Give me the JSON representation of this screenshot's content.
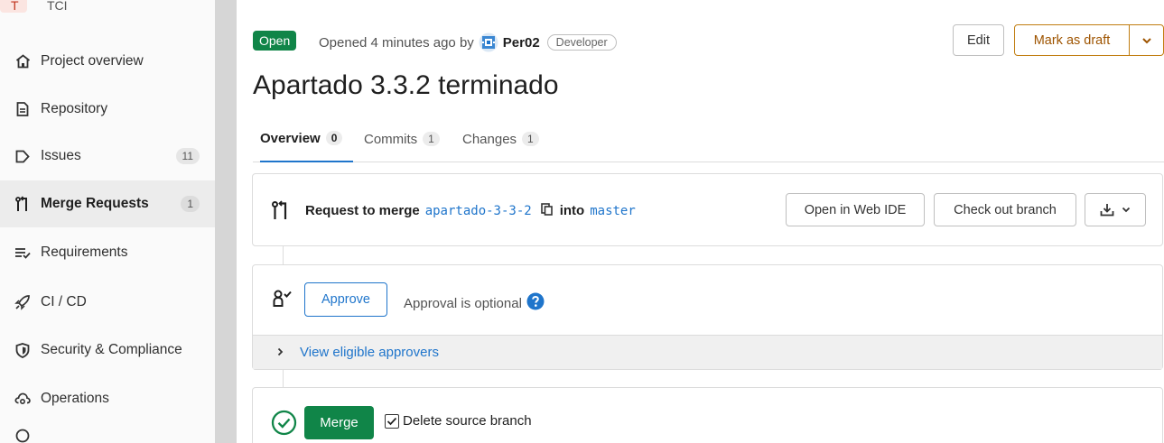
{
  "sidebar": {
    "top_fragment": "TCI",
    "avatar_letter": "T",
    "items": [
      {
        "label": "Project overview",
        "icon": "home-icon"
      },
      {
        "label": "Repository",
        "icon": "document-icon"
      },
      {
        "label": "Issues",
        "icon": "issues-icon",
        "count": "11"
      },
      {
        "label": "Merge Requests",
        "icon": "merge-request-icon",
        "count": "1",
        "active": true
      },
      {
        "label": "Requirements",
        "icon": "requirements-icon"
      },
      {
        "label": "CI / CD",
        "icon": "rocket-icon"
      },
      {
        "label": "Security & Compliance",
        "icon": "shield-icon"
      },
      {
        "label": "Operations",
        "icon": "cloud-gear-icon"
      }
    ]
  },
  "header": {
    "status": "Open",
    "opened_text": "Opened 4 minutes ago by",
    "author": "Per02",
    "role": "Developer",
    "edit_label": "Edit",
    "draft_label": "Mark as draft"
  },
  "title": "Apartado 3.3.2 terminado",
  "tabs": [
    {
      "label": "Overview",
      "count": "0",
      "active": true
    },
    {
      "label": "Commits",
      "count": "1"
    },
    {
      "label": "Changes",
      "count": "1"
    }
  ],
  "merge_info": {
    "prefix": "Request to merge",
    "source_branch": "apartado-3-3-2",
    "into": "into",
    "target_branch": "master",
    "web_ide_label": "Open in Web IDE",
    "checkout_label": "Check out branch"
  },
  "approval": {
    "approve_label": "Approve",
    "optional_text": "Approval is optional",
    "eligible_label": "View eligible approvers"
  },
  "merge": {
    "merge_label": "Merge",
    "delete_source_label": "Delete source branch"
  },
  "colors": {
    "green": "#108548",
    "blue": "#1f75cb",
    "orange": "#9e5400"
  }
}
